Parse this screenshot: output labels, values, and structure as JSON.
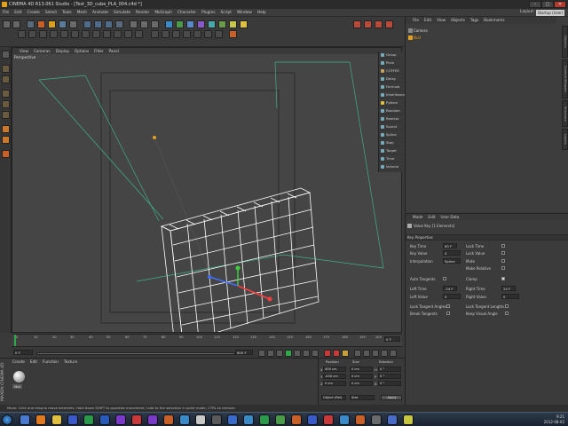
{
  "window": {
    "title": "CINEMA 4D R13.061 Studio - [Test_3D_cube_PLA_004.c4d *]",
    "minimize": "–",
    "maximize": "□",
    "close": "✕"
  },
  "menu": [
    "File",
    "Edit",
    "Create",
    "Select",
    "Tools",
    "Mesh",
    "Animate",
    "Simulate",
    "Render",
    "MoGraph",
    "Character",
    "Plugins",
    "Script",
    "Window",
    "Help"
  ],
  "layout": {
    "label": "Layout:",
    "value": "Startup (User)"
  },
  "viewport": {
    "menu": [
      "View",
      "Cameras",
      "Display",
      "Options",
      "Filter",
      "Panel"
    ],
    "label": "Perspective"
  },
  "object_palette": [
    "Group",
    "Plain",
    "COFFEE",
    "Delay",
    "Formula",
    "Inheritance",
    "Python",
    "Random",
    "Reactor",
    "Sound",
    "Spline",
    "Step",
    "Target",
    "Time",
    "Volume"
  ],
  "object_manager": {
    "menu": [
      "File",
      "Edit",
      "View",
      "Objects",
      "Tags",
      "Bookmarks"
    ],
    "rows": [
      "Camera",
      "Null"
    ],
    "side_tabs": [
      "Objects",
      "Content Browser",
      "Structure",
      "Layers"
    ]
  },
  "attributes": {
    "menu": [
      "Mode",
      "Edit",
      "User Data"
    ],
    "header": "Value Key [1 Elements]",
    "section": "Key Properties",
    "fields": {
      "key_time_label": "Key Time",
      "key_time": "60 F",
      "lock_time_label": "Lock Time",
      "key_value_label": "Key Value",
      "key_value": "0",
      "lock_value_label": "Lock Value",
      "interp_label": "Interpolation",
      "interp": "Spline",
      "mute_label": "Mute",
      "make_relative_label": "Make Relative",
      "auto_tangents_label": "Auto Tangents",
      "clamp_label": "Clamp",
      "left_time_label": "Left  Time",
      "left_time": "-24 F",
      "right_time_label": "Right Time",
      "right_time": "24 F",
      "left_value_label": "Left  Value",
      "left_value": "0",
      "right_value_label": "Right Value",
      "right_value": "0",
      "lock_tangent_angles_label": "Lock Tangent Angles",
      "lock_tangent_lengths_label": "Lock Tangent Lengths",
      "break_tangents_label": "Break Tangents",
      "keep_visual_angle_label": "Keep Visual Angle"
    }
  },
  "timeline": {
    "ticks": [
      "0",
      "10",
      "20",
      "30",
      "40",
      "50",
      "60",
      "70",
      "80",
      "90",
      "100",
      "110",
      "120",
      "130",
      "140",
      "150",
      "160",
      "170",
      "180",
      "190",
      "200"
    ],
    "right_value": "0 F"
  },
  "transport": {
    "start": "0 F",
    "end": "600 F"
  },
  "material": {
    "menu": [
      "Create",
      "Edit",
      "Function",
      "Texture"
    ],
    "name": "Mat"
  },
  "brand": "MAXON CINEMA 4D",
  "coordinates": {
    "headers": [
      "Position",
      "Size",
      "Rotation"
    ],
    "rows": [
      {
        "axis": "X",
        "pos": "400 cm",
        "size": "0 cm",
        "rot_label": "H",
        "rot": "0 °"
      },
      {
        "axis": "Y",
        "pos": "-450 cm",
        "size": "0 cm",
        "rot_label": "P",
        "rot": "0 °"
      },
      {
        "axis": "Z",
        "pos": "0 cm",
        "size": "0 cm",
        "rot_label": "B",
        "rot": "0 °"
      }
    ],
    "mode": "Object (Rel)",
    "size_mode": "Size",
    "apply": "Apply"
  },
  "status": "Move: Click and drag to move elements. Hold down SHIFT to quantize movement / add to the selection in point mode, CTRL to remove.",
  "clock": {
    "time": "9:21",
    "date": "2012-08-02"
  },
  "colors": {
    "accent": "#e0a020",
    "grid": "#3fb08a"
  }
}
